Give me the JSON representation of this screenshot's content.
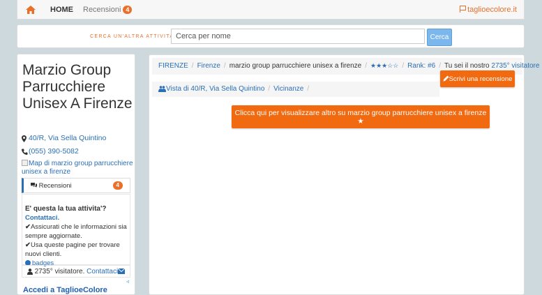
{
  "nav": {
    "home_label": "HOME",
    "reviews_label": "Recensioni",
    "reviews_count": "4",
    "brand": "taglioecolore.it"
  },
  "search": {
    "label": "CERCA UN'ALTRA ATTIVITA':",
    "placeholder": "Cerca per nome",
    "button": "Cerca"
  },
  "business": {
    "name": "Marzio Group Parrucchiere Unisex A Firenze",
    "address": "40/R, Via Sella Quintino",
    "phone": "(055) 390-5082",
    "map_alt": "Map di marzio group parrucchiere unisex a firenze"
  },
  "sidebar": {
    "reviews_label": "Recensioni",
    "reviews_count": "4",
    "owner_question": "E' questa la tua attivita'?",
    "contact_label": "Contattaci.",
    "line1": "Assicurati che le informazioni sia sempre aggiornate.",
    "line2": "Usa queste pagine per trovare nuovi clienti.",
    "badges_label": "badges",
    "visitors_text": "2735° visitatore.",
    "contact_link": "Contattaci",
    "ad_text": "Accedi a TaglioeColore come Salone di Bellezza"
  },
  "breadcrumb": {
    "region": "FIRENZE",
    "city": "Firenze",
    "business": "marzio group parrucchiere unisex a firenze",
    "stars": "★★★☆☆",
    "rank": "Rank: #6",
    "visitor_prefix": "Tu sei il nostro",
    "visitor_link": "2735° visitatore",
    "visitor_suffix": "."
  },
  "breadcrumb2": {
    "view": "Vista di 40/R, Via Sella Quintino",
    "nearby": "Vicinanze"
  },
  "buttons": {
    "write_review": "Scrivi una recensione",
    "more": "Clicca qui per visualizzare altro su marzio group parrucchiere unisex a firenze ★"
  },
  "colors": {
    "accent": "#f26a10",
    "link": "#2a6fb5",
    "background": "#cdd9dd"
  }
}
